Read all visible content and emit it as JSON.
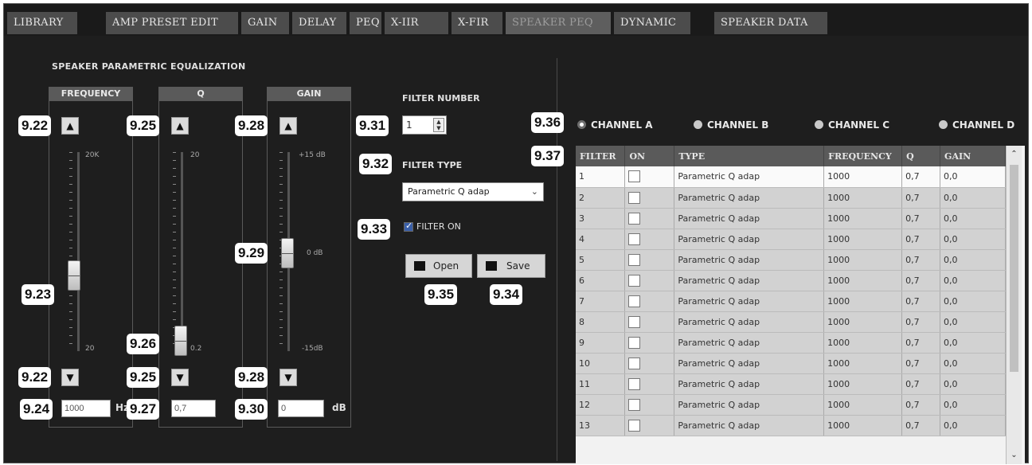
{
  "tabs": [
    "LIBRARY",
    "AMP PRESET EDIT",
    "GAIN",
    "DELAY",
    "PEQ",
    "X-IIR",
    "X-FIR",
    "SPEAKER PEQ",
    "DYNAMIC",
    "SPEAKER DATA"
  ],
  "active_tab": "SPEAKER PEQ",
  "section_title": "SPEAKER PARAMETRIC EQUALIZATION",
  "columns": {
    "frequency": {
      "header": "FREQUENCY",
      "scale_top": "20K",
      "scale_bottom": "20",
      "value": "1000",
      "unit": "Hz"
    },
    "q": {
      "header": "Q",
      "scale_top": "20",
      "scale_bottom": "0.2",
      "value": "0,7"
    },
    "gain": {
      "header": "GAIN",
      "scale_top": "+15 dB",
      "scale_mid": "0 dB",
      "scale_bottom": "-15dB",
      "value": "0",
      "unit": "dB"
    }
  },
  "filter_number": {
    "label": "FILTER NUMBER",
    "value": "1"
  },
  "filter_type": {
    "label": "FILTER TYPE",
    "value": "Parametric Q adap"
  },
  "filter_on": {
    "label": "FILTER ON",
    "checked": true
  },
  "buttons": {
    "open": "Open",
    "save": "Save"
  },
  "channels": [
    {
      "label": "CHANNEL A",
      "selected": true
    },
    {
      "label": "CHANNEL B",
      "selected": false
    },
    {
      "label": "CHANNEL C",
      "selected": false
    },
    {
      "label": "CHANNEL D",
      "selected": false
    }
  ],
  "badges": {
    "b922": "9.22",
    "b923": "9.23",
    "b924": "9.24",
    "b925": "9.25",
    "b926": "9.26",
    "b927": "9.27",
    "b928": "9.28",
    "b929": "9.29",
    "b930": "9.30",
    "b931": "9.31",
    "b932": "9.32",
    "b933": "9.33",
    "b934": "9.34",
    "b935": "9.35",
    "b936": "9.36",
    "b937": "9.37"
  },
  "table": {
    "headers": [
      "FILTER",
      "ON",
      "TYPE",
      "FREQUENCY",
      "Q",
      "GAIN"
    ],
    "rows": [
      [
        "1",
        "",
        "Parametric Q adap",
        "1000",
        "0,7",
        "0,0"
      ],
      [
        "2",
        "",
        "Parametric Q adap",
        "1000",
        "0,7",
        "0,0"
      ],
      [
        "3",
        "",
        "Parametric Q adap",
        "1000",
        "0,7",
        "0,0"
      ],
      [
        "4",
        "",
        "Parametric Q adap",
        "1000",
        "0,7",
        "0,0"
      ],
      [
        "5",
        "",
        "Parametric Q adap",
        "1000",
        "0,7",
        "0,0"
      ],
      [
        "6",
        "",
        "Parametric Q adap",
        "1000",
        "0,7",
        "0,0"
      ],
      [
        "7",
        "",
        "Parametric Q adap",
        "1000",
        "0,7",
        "0,0"
      ],
      [
        "8",
        "",
        "Parametric Q adap",
        "1000",
        "0,7",
        "0,0"
      ],
      [
        "9",
        "",
        "Parametric Q adap",
        "1000",
        "0,7",
        "0,0"
      ],
      [
        "10",
        "",
        "Parametric Q adap",
        "1000",
        "0,7",
        "0,0"
      ],
      [
        "11",
        "",
        "Parametric Q adap",
        "1000",
        "0,7",
        "0,0"
      ],
      [
        "12",
        "",
        "Parametric Q adap",
        "1000",
        "0,7",
        "0,0"
      ],
      [
        "13",
        "",
        "Parametric Q adap",
        "1000",
        "0,7",
        "0,0"
      ]
    ]
  }
}
